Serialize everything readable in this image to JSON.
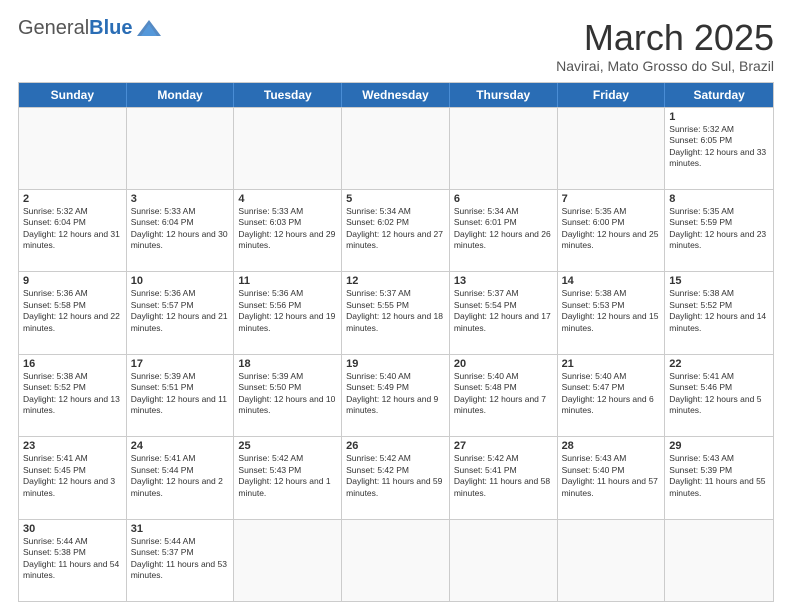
{
  "header": {
    "logo_general": "General",
    "logo_blue": "Blue",
    "month_title": "March 2025",
    "subtitle": "Navirai, Mato Grosso do Sul, Brazil"
  },
  "day_headers": [
    "Sunday",
    "Monday",
    "Tuesday",
    "Wednesday",
    "Thursday",
    "Friday",
    "Saturday"
  ],
  "weeks": [
    [
      {
        "date": "",
        "info": ""
      },
      {
        "date": "",
        "info": ""
      },
      {
        "date": "",
        "info": ""
      },
      {
        "date": "",
        "info": ""
      },
      {
        "date": "",
        "info": ""
      },
      {
        "date": "",
        "info": ""
      },
      {
        "date": "1",
        "info": "Sunrise: 5:32 AM\nSunset: 6:05 PM\nDaylight: 12 hours and 33 minutes."
      }
    ],
    [
      {
        "date": "2",
        "info": "Sunrise: 5:32 AM\nSunset: 6:04 PM\nDaylight: 12 hours and 31 minutes."
      },
      {
        "date": "3",
        "info": "Sunrise: 5:33 AM\nSunset: 6:04 PM\nDaylight: 12 hours and 30 minutes."
      },
      {
        "date": "4",
        "info": "Sunrise: 5:33 AM\nSunset: 6:03 PM\nDaylight: 12 hours and 29 minutes."
      },
      {
        "date": "5",
        "info": "Sunrise: 5:34 AM\nSunset: 6:02 PM\nDaylight: 12 hours and 27 minutes."
      },
      {
        "date": "6",
        "info": "Sunrise: 5:34 AM\nSunset: 6:01 PM\nDaylight: 12 hours and 26 minutes."
      },
      {
        "date": "7",
        "info": "Sunrise: 5:35 AM\nSunset: 6:00 PM\nDaylight: 12 hours and 25 minutes."
      },
      {
        "date": "8",
        "info": "Sunrise: 5:35 AM\nSunset: 5:59 PM\nDaylight: 12 hours and 23 minutes."
      }
    ],
    [
      {
        "date": "9",
        "info": "Sunrise: 5:36 AM\nSunset: 5:58 PM\nDaylight: 12 hours and 22 minutes."
      },
      {
        "date": "10",
        "info": "Sunrise: 5:36 AM\nSunset: 5:57 PM\nDaylight: 12 hours and 21 minutes."
      },
      {
        "date": "11",
        "info": "Sunrise: 5:36 AM\nSunset: 5:56 PM\nDaylight: 12 hours and 19 minutes."
      },
      {
        "date": "12",
        "info": "Sunrise: 5:37 AM\nSunset: 5:55 PM\nDaylight: 12 hours and 18 minutes."
      },
      {
        "date": "13",
        "info": "Sunrise: 5:37 AM\nSunset: 5:54 PM\nDaylight: 12 hours and 17 minutes."
      },
      {
        "date": "14",
        "info": "Sunrise: 5:38 AM\nSunset: 5:53 PM\nDaylight: 12 hours and 15 minutes."
      },
      {
        "date": "15",
        "info": "Sunrise: 5:38 AM\nSunset: 5:52 PM\nDaylight: 12 hours and 14 minutes."
      }
    ],
    [
      {
        "date": "16",
        "info": "Sunrise: 5:38 AM\nSunset: 5:52 PM\nDaylight: 12 hours and 13 minutes."
      },
      {
        "date": "17",
        "info": "Sunrise: 5:39 AM\nSunset: 5:51 PM\nDaylight: 12 hours and 11 minutes."
      },
      {
        "date": "18",
        "info": "Sunrise: 5:39 AM\nSunset: 5:50 PM\nDaylight: 12 hours and 10 minutes."
      },
      {
        "date": "19",
        "info": "Sunrise: 5:40 AM\nSunset: 5:49 PM\nDaylight: 12 hours and 9 minutes."
      },
      {
        "date": "20",
        "info": "Sunrise: 5:40 AM\nSunset: 5:48 PM\nDaylight: 12 hours and 7 minutes."
      },
      {
        "date": "21",
        "info": "Sunrise: 5:40 AM\nSunset: 5:47 PM\nDaylight: 12 hours and 6 minutes."
      },
      {
        "date": "22",
        "info": "Sunrise: 5:41 AM\nSunset: 5:46 PM\nDaylight: 12 hours and 5 minutes."
      }
    ],
    [
      {
        "date": "23",
        "info": "Sunrise: 5:41 AM\nSunset: 5:45 PM\nDaylight: 12 hours and 3 minutes."
      },
      {
        "date": "24",
        "info": "Sunrise: 5:41 AM\nSunset: 5:44 PM\nDaylight: 12 hours and 2 minutes."
      },
      {
        "date": "25",
        "info": "Sunrise: 5:42 AM\nSunset: 5:43 PM\nDaylight: 12 hours and 1 minute."
      },
      {
        "date": "26",
        "info": "Sunrise: 5:42 AM\nSunset: 5:42 PM\nDaylight: 11 hours and 59 minutes."
      },
      {
        "date": "27",
        "info": "Sunrise: 5:42 AM\nSunset: 5:41 PM\nDaylight: 11 hours and 58 minutes."
      },
      {
        "date": "28",
        "info": "Sunrise: 5:43 AM\nSunset: 5:40 PM\nDaylight: 11 hours and 57 minutes."
      },
      {
        "date": "29",
        "info": "Sunrise: 5:43 AM\nSunset: 5:39 PM\nDaylight: 11 hours and 55 minutes."
      }
    ],
    [
      {
        "date": "30",
        "info": "Sunrise: 5:44 AM\nSunset: 5:38 PM\nDaylight: 11 hours and 54 minutes."
      },
      {
        "date": "31",
        "info": "Sunrise: 5:44 AM\nSunset: 5:37 PM\nDaylight: 11 hours and 53 minutes."
      },
      {
        "date": "",
        "info": ""
      },
      {
        "date": "",
        "info": ""
      },
      {
        "date": "",
        "info": ""
      },
      {
        "date": "",
        "info": ""
      },
      {
        "date": "",
        "info": ""
      }
    ]
  ]
}
